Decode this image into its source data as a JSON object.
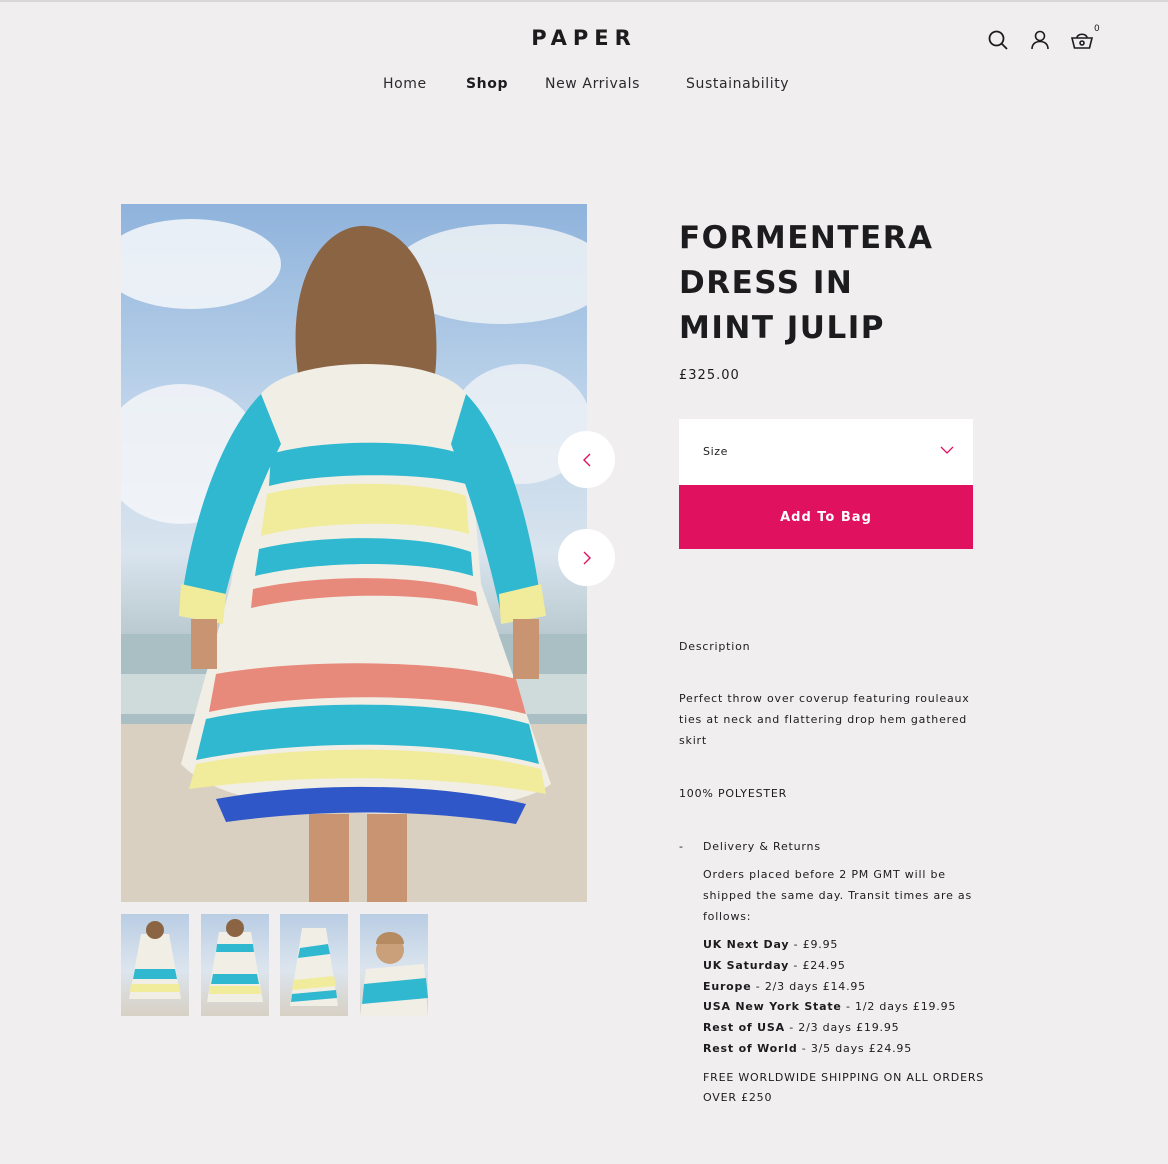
{
  "header": {
    "logo": "PAPER",
    "cart_count": "0",
    "nav": [
      {
        "label": "Home",
        "active": false
      },
      {
        "label": "Shop",
        "active": true
      },
      {
        "label": "New Arrivals",
        "active": false
      },
      {
        "label": "Sustainability",
        "active": false
      }
    ],
    "icons": [
      "search-icon",
      "account-icon",
      "basket-icon"
    ]
  },
  "gallery": {
    "thumbnail_count": 4,
    "prev_icon": "chevron-left-icon",
    "next_icon": "chevron-right-icon"
  },
  "product": {
    "title_lines": [
      "FORMENTERA",
      "DRESS IN",
      "MINT JULIP"
    ],
    "price": "£325.00",
    "size_label": "Size",
    "add_to_bag": "Add To Bag",
    "description_heading": "Description",
    "description": "Perfect throw over coverup featuring rouleaux ties at neck and flattering drop hem gathered skirt",
    "composition": "100% POLYESTER",
    "delivery": {
      "toggle": "-",
      "title": "Delivery & Returns",
      "intro": "Orders placed before 2 PM GMT will be shipped the same day. Transit times are as follows:",
      "options": [
        {
          "name": "UK Next Day",
          "detail": " - £9.95"
        },
        {
          "name": "UK Saturday",
          "detail": " - £24.95"
        },
        {
          "name": "Europe",
          "detail": " - 2/3 days £14.95"
        },
        {
          "name": "USA New York State",
          "detail": " - 1/2 days £19.95"
        },
        {
          "name": "Rest of USA",
          "detail": " - 2/3 days £19.95"
        },
        {
          "name": "Rest of World",
          "detail": " - 3/5 days £24.95"
        }
      ],
      "free_shipping": "FREE WORLDWIDE SHIPPING ON ALL ORDERS OVER £250"
    }
  },
  "colors": {
    "background": "#f0eeef",
    "accent": "#e0115f",
    "text": "#1c1c1e"
  }
}
